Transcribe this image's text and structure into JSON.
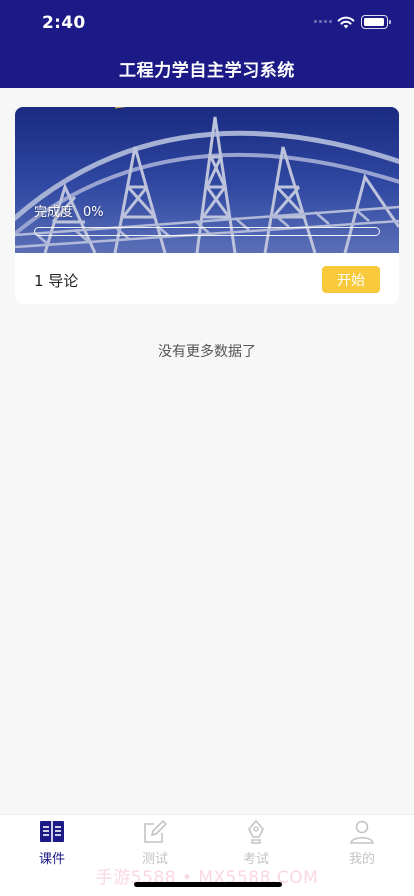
{
  "status_bar": {
    "time": "2:40"
  },
  "header": {
    "title": "工程力学自主学习系统"
  },
  "course_card": {
    "progress_label": "完成度",
    "progress_value_text": "0%",
    "progress_fraction": 0,
    "lesson_name": "1 导论",
    "start_label": "开始"
  },
  "list_footer": "没有更多数据了",
  "tabs": [
    {
      "label": "课件",
      "icon": "book-icon",
      "active": true
    },
    {
      "label": "测试",
      "icon": "edit-icon",
      "active": false
    },
    {
      "label": "考试",
      "icon": "pen-icon",
      "active": false
    },
    {
      "label": "我的",
      "icon": "person-icon",
      "active": false
    }
  ],
  "watermark": "手游5588 • MX5588.COM",
  "colors": {
    "brand": "#1b1a86",
    "start_button": "#f7c93b",
    "tab_inactive": "#c4c4c4"
  }
}
